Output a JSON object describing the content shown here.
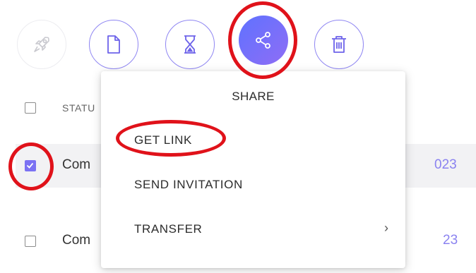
{
  "toolbar": {
    "buttons": [
      {
        "name": "rocket",
        "icon": "rocket-icon",
        "state": "disabled"
      },
      {
        "name": "document",
        "icon": "document-icon",
        "state": "normal"
      },
      {
        "name": "hourglass",
        "icon": "hourglass-icon",
        "state": "normal"
      },
      {
        "name": "share",
        "icon": "share-icon",
        "state": "active"
      },
      {
        "name": "delete",
        "icon": "trash-icon",
        "state": "normal"
      }
    ]
  },
  "table": {
    "header": {
      "status_label": "STATU"
    },
    "rows": [
      {
        "checked": true,
        "status": "Com",
        "date": "023"
      },
      {
        "checked": false,
        "status": "Com",
        "date": "23"
      }
    ]
  },
  "menu": {
    "title": "SHARE",
    "items": [
      {
        "label": "GET LINK"
      },
      {
        "label": "SEND INVITATION"
      },
      {
        "label": "TRANSFER",
        "submenu_icon": "chevron-right-icon",
        "submenu_glyph": "›"
      }
    ]
  },
  "colors": {
    "accent": "#7b72f3",
    "accent_gradient_start": "#5f72ff",
    "accent_gradient_end": "#8f6df5",
    "annotation_red": "#e0121a",
    "selected_row_bg": "#f2f2f4"
  }
}
